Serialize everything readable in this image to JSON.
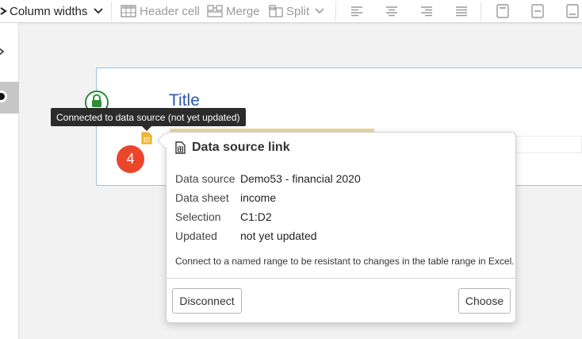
{
  "toolbar": {
    "column_widths": "Column widths",
    "header_cell": "Header cell",
    "merge": "Merge",
    "split": "Split"
  },
  "content": {
    "title": "Title",
    "badge": "4"
  },
  "tooltip": {
    "text": "Connected to data source (not yet updated)"
  },
  "popover": {
    "title": "Data source link",
    "rows": [
      {
        "label": "Data source",
        "value": "Demo53 - financial 2020"
      },
      {
        "label": "Data sheet",
        "value": "income"
      },
      {
        "label": "Selection",
        "value": "C1:D2"
      },
      {
        "label": "Updated",
        "value": "not yet updated"
      }
    ],
    "note": "Connect to a named range to be resistant to changes in the table range in Excel.",
    "disconnect_label": "Disconnect",
    "choose_label": "Choose"
  },
  "colors": {
    "badge": "#e9462b",
    "title": "#2b58a8",
    "lock": "#2f8d3a",
    "datasource_icon": "#e8a317",
    "tooltip_bg": "#2b2b2b"
  }
}
